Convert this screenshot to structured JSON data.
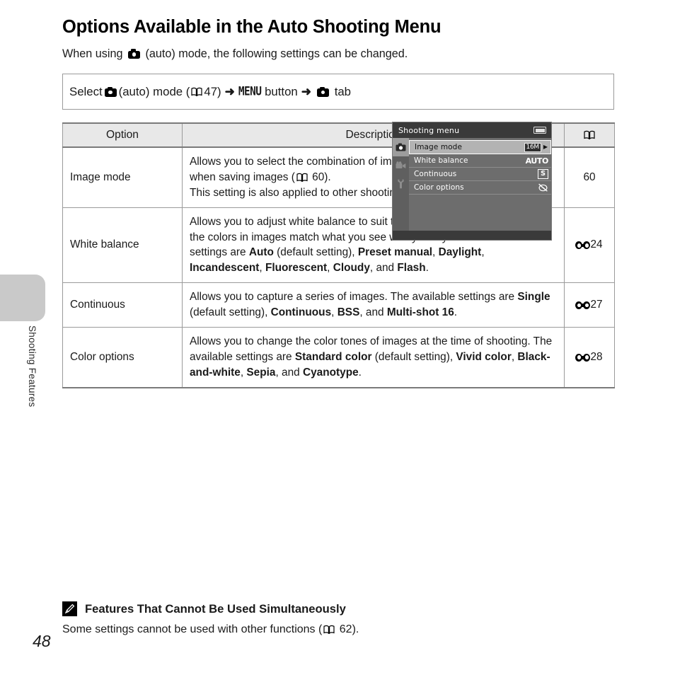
{
  "page": {
    "number": "48",
    "section_label": "Shooting Features",
    "title": "Options Available in the Auto Shooting Menu"
  },
  "intro": {
    "before_icon": "When using ",
    "icon": "camera-auto-icon",
    "after_icon": " (auto) mode, the following settings can be changed."
  },
  "select_path": {
    "select_word": "Select",
    "mode_icon": "camera-auto-icon",
    "mode_text": "(auto) mode (",
    "book_icon": "book-icon",
    "page_ref": "47",
    "close_paren": ")",
    "arrow": "➜",
    "menu_button": "MENU",
    "button_word": "button",
    "arrow2": "➜",
    "tab_icon": "camera-auto-icon",
    "tab_word": "tab"
  },
  "lcd": {
    "title": "Shooting menu",
    "battery_icon": "battery-icon",
    "tabs": [
      {
        "name": "shooting-tab",
        "icon": "camera-icon",
        "active": true
      },
      {
        "name": "movie-tab",
        "icon": "movie-camera-icon",
        "active": false
      },
      {
        "name": "setup-tab",
        "icon": "wrench-icon",
        "active": false
      }
    ],
    "rows": [
      {
        "label": "Image mode",
        "value": "16M",
        "value_icon": "image-size-badge",
        "selected": true
      },
      {
        "label": "White balance",
        "value": "AUTO",
        "value_icon": "auto-wb-text",
        "selected": false
      },
      {
        "label": "Continuous",
        "value": "S",
        "value_icon": "single-shot-icon",
        "selected": false
      },
      {
        "label": "Color options",
        "value": "",
        "value_icon": "color-off-icon",
        "selected": false
      }
    ]
  },
  "table": {
    "headers": {
      "option": "Option",
      "description": "Description",
      "reference": "book-icon"
    },
    "rows": [
      {
        "option": "Image mode",
        "description_parts": [
          {
            "t": "Allows you to select the combination of image size and image quality used when saving images (",
            "b": false
          },
          {
            "t": " ",
            "b": false,
            "icon": "book-icon"
          },
          {
            "t": " 60).",
            "b": false
          },
          {
            "t": "\n",
            "b": false,
            "br": true
          },
          {
            "t": "This setting is also applied to other shooting modes.",
            "b": false
          }
        ],
        "ref_icon": "",
        "ref": "60"
      },
      {
        "option": "White balance",
        "description_parts": [
          {
            "t": "Allows you to adjust white balance to suit the light source in order to make the colors in images match what you see with your eye. The available settings are ",
            "b": false
          },
          {
            "t": "Auto",
            "b": true
          },
          {
            "t": " (default setting), ",
            "b": false
          },
          {
            "t": "Preset manual",
            "b": true
          },
          {
            "t": ", ",
            "b": false
          },
          {
            "t": "Daylight",
            "b": true
          },
          {
            "t": ", ",
            "b": false
          },
          {
            "t": "Incandescent",
            "b": true
          },
          {
            "t": ", ",
            "b": false
          },
          {
            "t": "Fluorescent",
            "b": true
          },
          {
            "t": ", ",
            "b": false
          },
          {
            "t": "Cloudy",
            "b": true
          },
          {
            "t": ", and ",
            "b": false
          },
          {
            "t": "Flash",
            "b": true
          },
          {
            "t": ".",
            "b": false
          }
        ],
        "ref_icon": "reference-section-icon",
        "ref": "24"
      },
      {
        "option": "Continuous",
        "description_parts": [
          {
            "t": "Allows you to capture a series of images. The available settings are ",
            "b": false
          },
          {
            "t": "Single",
            "b": true
          },
          {
            "t": " (default setting), ",
            "b": false
          },
          {
            "t": "Continuous",
            "b": true
          },
          {
            "t": ", ",
            "b": false
          },
          {
            "t": "BSS",
            "b": true
          },
          {
            "t": ", and ",
            "b": false
          },
          {
            "t": "Multi-shot 16",
            "b": true
          },
          {
            "t": ".",
            "b": false
          }
        ],
        "ref_icon": "reference-section-icon",
        "ref": "27"
      },
      {
        "option": "Color options",
        "description_parts": [
          {
            "t": "Allows you to change the color tones of images at the time of shooting. The available settings are ",
            "b": false
          },
          {
            "t": "Standard color",
            "b": true
          },
          {
            "t": " (default setting), ",
            "b": false
          },
          {
            "t": "Vivid color",
            "b": true
          },
          {
            "t": ", ",
            "b": false
          },
          {
            "t": "Black-and-white",
            "b": true
          },
          {
            "t": ", ",
            "b": false
          },
          {
            "t": "Sepia",
            "b": true
          },
          {
            "t": ", and ",
            "b": false
          },
          {
            "t": "Cyanotype",
            "b": true
          },
          {
            "t": ".",
            "b": false
          }
        ],
        "ref_icon": "reference-section-icon",
        "ref": "28"
      }
    ]
  },
  "note": {
    "icon": "pencil-note-icon",
    "heading": "Features That Cannot Be Used Simultaneously",
    "body_before": "Some settings cannot be used with other functions (",
    "body_icon": "book-icon",
    "body_page": "62",
    "body_after": ")."
  }
}
